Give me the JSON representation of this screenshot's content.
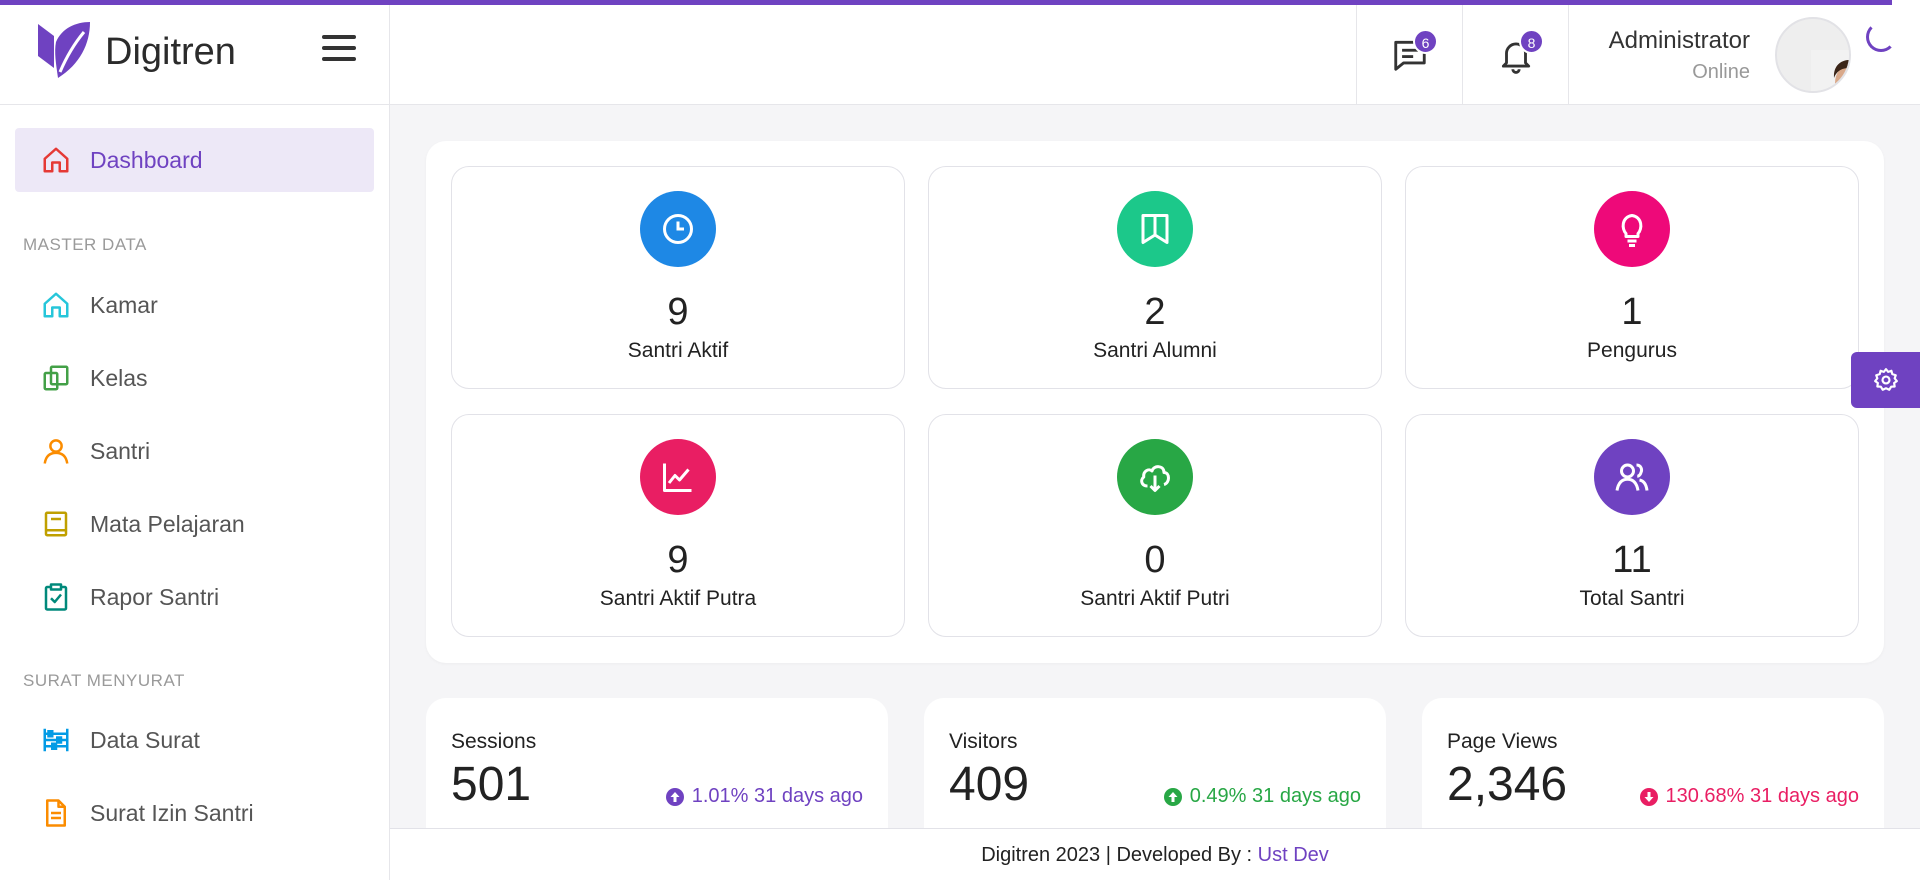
{
  "app": {
    "name": "Digitren"
  },
  "header": {
    "messages_count": "6",
    "notifications_count": "8",
    "user_name": "Administrator",
    "user_status": "Online"
  },
  "sidebar": {
    "dashboard": "Dashboard",
    "section_master": "MASTER DATA",
    "master_items": [
      "Kamar",
      "Kelas",
      "Santri",
      "Mata Pelajaran",
      "Rapor Santri"
    ],
    "section_surat": "SURAT MENYURAT",
    "surat_items": [
      "Data Surat",
      "Surat Izin Santri"
    ]
  },
  "stats": [
    {
      "value": "9",
      "label": "Santri Aktif",
      "color": "#1e88e5",
      "icon": "clock-icon"
    },
    {
      "value": "2",
      "label": "Santri Alumni",
      "color": "#1cc88a",
      "icon": "bookmark-book-icon"
    },
    {
      "value": "1",
      "label": "Pengurus",
      "color": "#ee0979",
      "icon": "lightbulb-icon"
    },
    {
      "value": "9",
      "label": "Santri Aktif Putra",
      "color": "#e91e63",
      "icon": "chart-line-icon"
    },
    {
      "value": "0",
      "label": "Santri Aktif Putri",
      "color": "#28a745",
      "icon": "cloud-download-icon"
    },
    {
      "value": "11",
      "label": "Total Santri",
      "color": "#6f42c1",
      "icon": "users-icon"
    }
  ],
  "metrics": [
    {
      "title": "Sessions",
      "value": "501",
      "change": "1.01% 31 days ago",
      "color": "#6f42c1",
      "direction": "up"
    },
    {
      "title": "Visitors",
      "value": "409",
      "change": "0.49% 31 days ago",
      "color": "#28a745",
      "direction": "up"
    },
    {
      "title": "Page Views",
      "value": "2,346",
      "change": "130.68% 31 days ago",
      "color": "#e91e63",
      "direction": "down"
    }
  ],
  "footer": {
    "text": "Digitren 2023 | Developed By : ",
    "link": "Ust Dev"
  }
}
